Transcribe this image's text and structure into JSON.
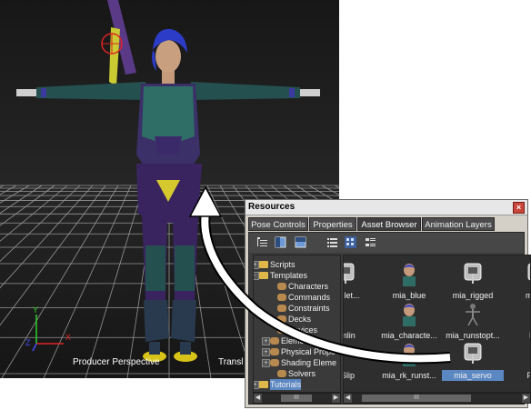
{
  "viewport": {
    "camera_label": "Producer Perspective",
    "mode_label": "Transl",
    "axes": {
      "x": "X",
      "y": "Y",
      "z": "Z"
    }
  },
  "resources": {
    "title": "Resources",
    "close_icon": "close-icon",
    "tabs": [
      {
        "label": "Pose Controls"
      },
      {
        "label": "Properties"
      },
      {
        "label": "Asset Browser"
      },
      {
        "label": "Animation Layers"
      }
    ],
    "active_tab": "Asset Browser",
    "tree": [
      {
        "label": "Scripts",
        "icon": "folder-icon",
        "expander": "+"
      },
      {
        "label": "Templates",
        "icon": "folder-icon",
        "expander": "-"
      },
      {
        "label": "Characters",
        "icon": "template-icon"
      },
      {
        "label": "Commands",
        "icon": "template-icon"
      },
      {
        "label": "Constraints",
        "icon": "template-icon"
      },
      {
        "label": "Decks",
        "icon": "template-icon"
      },
      {
        "label": "Devices",
        "icon": "template-icon"
      },
      {
        "label": "Elements",
        "icon": "template-icon",
        "expander": "+"
      },
      {
        "label": "Physical Prope",
        "icon": "template-icon",
        "expander": "+"
      },
      {
        "label": "Shading Eleme",
        "icon": "template-icon",
        "expander": "+"
      },
      {
        "label": "Solvers",
        "icon": "template-icon"
      },
      {
        "label": "Tutorials",
        "icon": "folder-icon",
        "expander": "+",
        "selected": true
      }
    ],
    "assets": [
      {
        "name": "skelet...",
        "kind": "skeleton"
      },
      {
        "name": "mia_blue",
        "kind": "character"
      },
      {
        "name": "mia_rigged",
        "kind": "skeleton"
      },
      {
        "name": "mia_s",
        "kind": "skeleton"
      },
      {
        "name": "emlin",
        "kind": "blank"
      },
      {
        "name": "mia_characte...",
        "kind": "character"
      },
      {
        "name": "mia_runstopt...",
        "kind": "figure"
      },
      {
        "name": "Pep",
        "kind": "blank"
      },
      {
        "name": "eSlip",
        "kind": "blank"
      },
      {
        "name": "mia_rk_runst...",
        "kind": "character"
      },
      {
        "name": "mia_servo",
        "kind": "skeleton",
        "selected": true
      },
      {
        "name": "Pepe",
        "kind": "doc"
      }
    ],
    "scroll_grip": "III"
  }
}
